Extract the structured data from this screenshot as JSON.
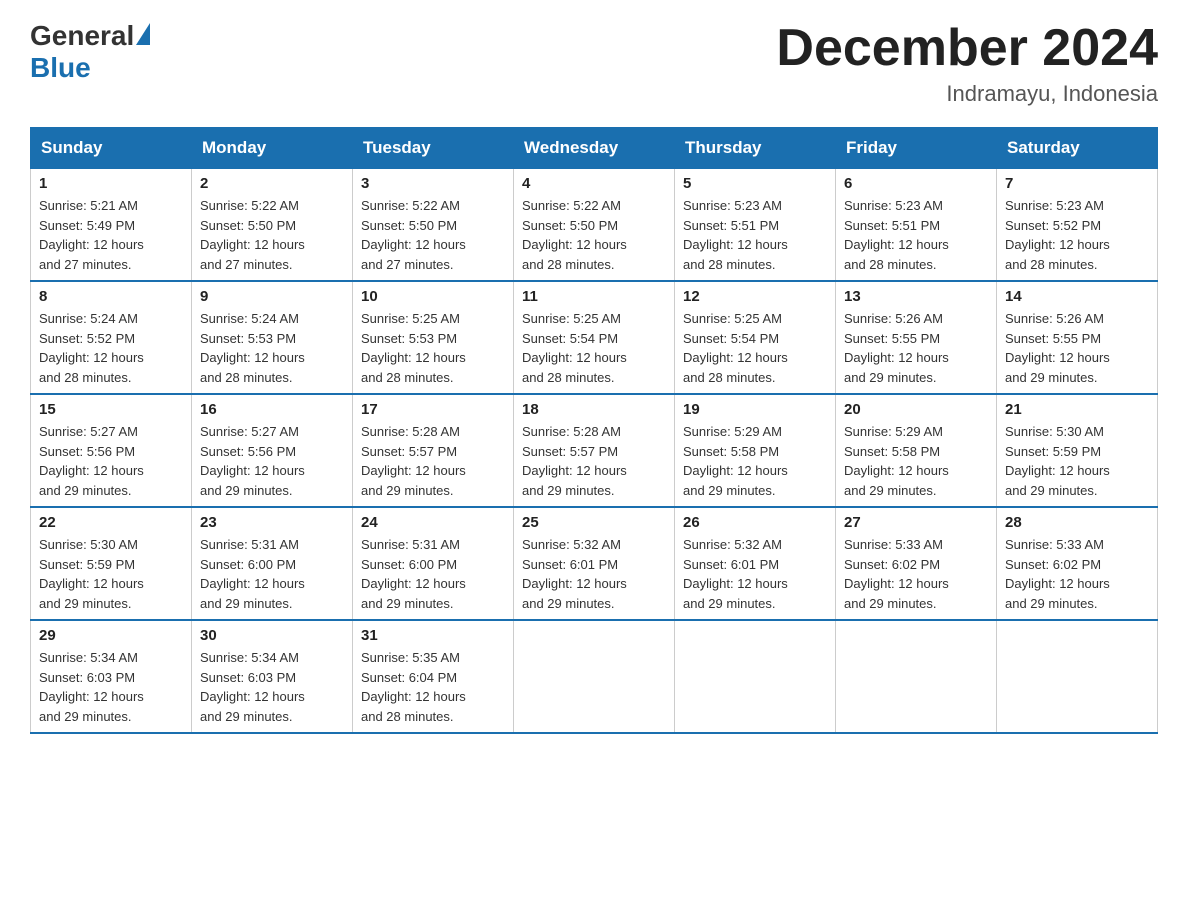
{
  "header": {
    "logo_general": "General",
    "logo_blue": "Blue",
    "title": "December 2024",
    "subtitle": "Indramayu, Indonesia"
  },
  "weekdays": [
    "Sunday",
    "Monday",
    "Tuesday",
    "Wednesday",
    "Thursday",
    "Friday",
    "Saturday"
  ],
  "weeks": [
    [
      {
        "day": "1",
        "sunrise": "5:21 AM",
        "sunset": "5:49 PM",
        "daylight": "12 hours and 27 minutes."
      },
      {
        "day": "2",
        "sunrise": "5:22 AM",
        "sunset": "5:50 PM",
        "daylight": "12 hours and 27 minutes."
      },
      {
        "day": "3",
        "sunrise": "5:22 AM",
        "sunset": "5:50 PM",
        "daylight": "12 hours and 27 minutes."
      },
      {
        "day": "4",
        "sunrise": "5:22 AM",
        "sunset": "5:50 PM",
        "daylight": "12 hours and 28 minutes."
      },
      {
        "day": "5",
        "sunrise": "5:23 AM",
        "sunset": "5:51 PM",
        "daylight": "12 hours and 28 minutes."
      },
      {
        "day": "6",
        "sunrise": "5:23 AM",
        "sunset": "5:51 PM",
        "daylight": "12 hours and 28 minutes."
      },
      {
        "day": "7",
        "sunrise": "5:23 AM",
        "sunset": "5:52 PM",
        "daylight": "12 hours and 28 minutes."
      }
    ],
    [
      {
        "day": "8",
        "sunrise": "5:24 AM",
        "sunset": "5:52 PM",
        "daylight": "12 hours and 28 minutes."
      },
      {
        "day": "9",
        "sunrise": "5:24 AM",
        "sunset": "5:53 PM",
        "daylight": "12 hours and 28 minutes."
      },
      {
        "day": "10",
        "sunrise": "5:25 AM",
        "sunset": "5:53 PM",
        "daylight": "12 hours and 28 minutes."
      },
      {
        "day": "11",
        "sunrise": "5:25 AM",
        "sunset": "5:54 PM",
        "daylight": "12 hours and 28 minutes."
      },
      {
        "day": "12",
        "sunrise": "5:25 AM",
        "sunset": "5:54 PM",
        "daylight": "12 hours and 28 minutes."
      },
      {
        "day": "13",
        "sunrise": "5:26 AM",
        "sunset": "5:55 PM",
        "daylight": "12 hours and 29 minutes."
      },
      {
        "day": "14",
        "sunrise": "5:26 AM",
        "sunset": "5:55 PM",
        "daylight": "12 hours and 29 minutes."
      }
    ],
    [
      {
        "day": "15",
        "sunrise": "5:27 AM",
        "sunset": "5:56 PM",
        "daylight": "12 hours and 29 minutes."
      },
      {
        "day": "16",
        "sunrise": "5:27 AM",
        "sunset": "5:56 PM",
        "daylight": "12 hours and 29 minutes."
      },
      {
        "day": "17",
        "sunrise": "5:28 AM",
        "sunset": "5:57 PM",
        "daylight": "12 hours and 29 minutes."
      },
      {
        "day": "18",
        "sunrise": "5:28 AM",
        "sunset": "5:57 PM",
        "daylight": "12 hours and 29 minutes."
      },
      {
        "day": "19",
        "sunrise": "5:29 AM",
        "sunset": "5:58 PM",
        "daylight": "12 hours and 29 minutes."
      },
      {
        "day": "20",
        "sunrise": "5:29 AM",
        "sunset": "5:58 PM",
        "daylight": "12 hours and 29 minutes."
      },
      {
        "day": "21",
        "sunrise": "5:30 AM",
        "sunset": "5:59 PM",
        "daylight": "12 hours and 29 minutes."
      }
    ],
    [
      {
        "day": "22",
        "sunrise": "5:30 AM",
        "sunset": "5:59 PM",
        "daylight": "12 hours and 29 minutes."
      },
      {
        "day": "23",
        "sunrise": "5:31 AM",
        "sunset": "6:00 PM",
        "daylight": "12 hours and 29 minutes."
      },
      {
        "day": "24",
        "sunrise": "5:31 AM",
        "sunset": "6:00 PM",
        "daylight": "12 hours and 29 minutes."
      },
      {
        "day": "25",
        "sunrise": "5:32 AM",
        "sunset": "6:01 PM",
        "daylight": "12 hours and 29 minutes."
      },
      {
        "day": "26",
        "sunrise": "5:32 AM",
        "sunset": "6:01 PM",
        "daylight": "12 hours and 29 minutes."
      },
      {
        "day": "27",
        "sunrise": "5:33 AM",
        "sunset": "6:02 PM",
        "daylight": "12 hours and 29 minutes."
      },
      {
        "day": "28",
        "sunrise": "5:33 AM",
        "sunset": "6:02 PM",
        "daylight": "12 hours and 29 minutes."
      }
    ],
    [
      {
        "day": "29",
        "sunrise": "5:34 AM",
        "sunset": "6:03 PM",
        "daylight": "12 hours and 29 minutes."
      },
      {
        "day": "30",
        "sunrise": "5:34 AM",
        "sunset": "6:03 PM",
        "daylight": "12 hours and 29 minutes."
      },
      {
        "day": "31",
        "sunrise": "5:35 AM",
        "sunset": "6:04 PM",
        "daylight": "12 hours and 28 minutes."
      },
      null,
      null,
      null,
      null
    ]
  ],
  "labels": {
    "sunrise": "Sunrise:",
    "sunset": "Sunset:",
    "daylight": "Daylight:"
  }
}
